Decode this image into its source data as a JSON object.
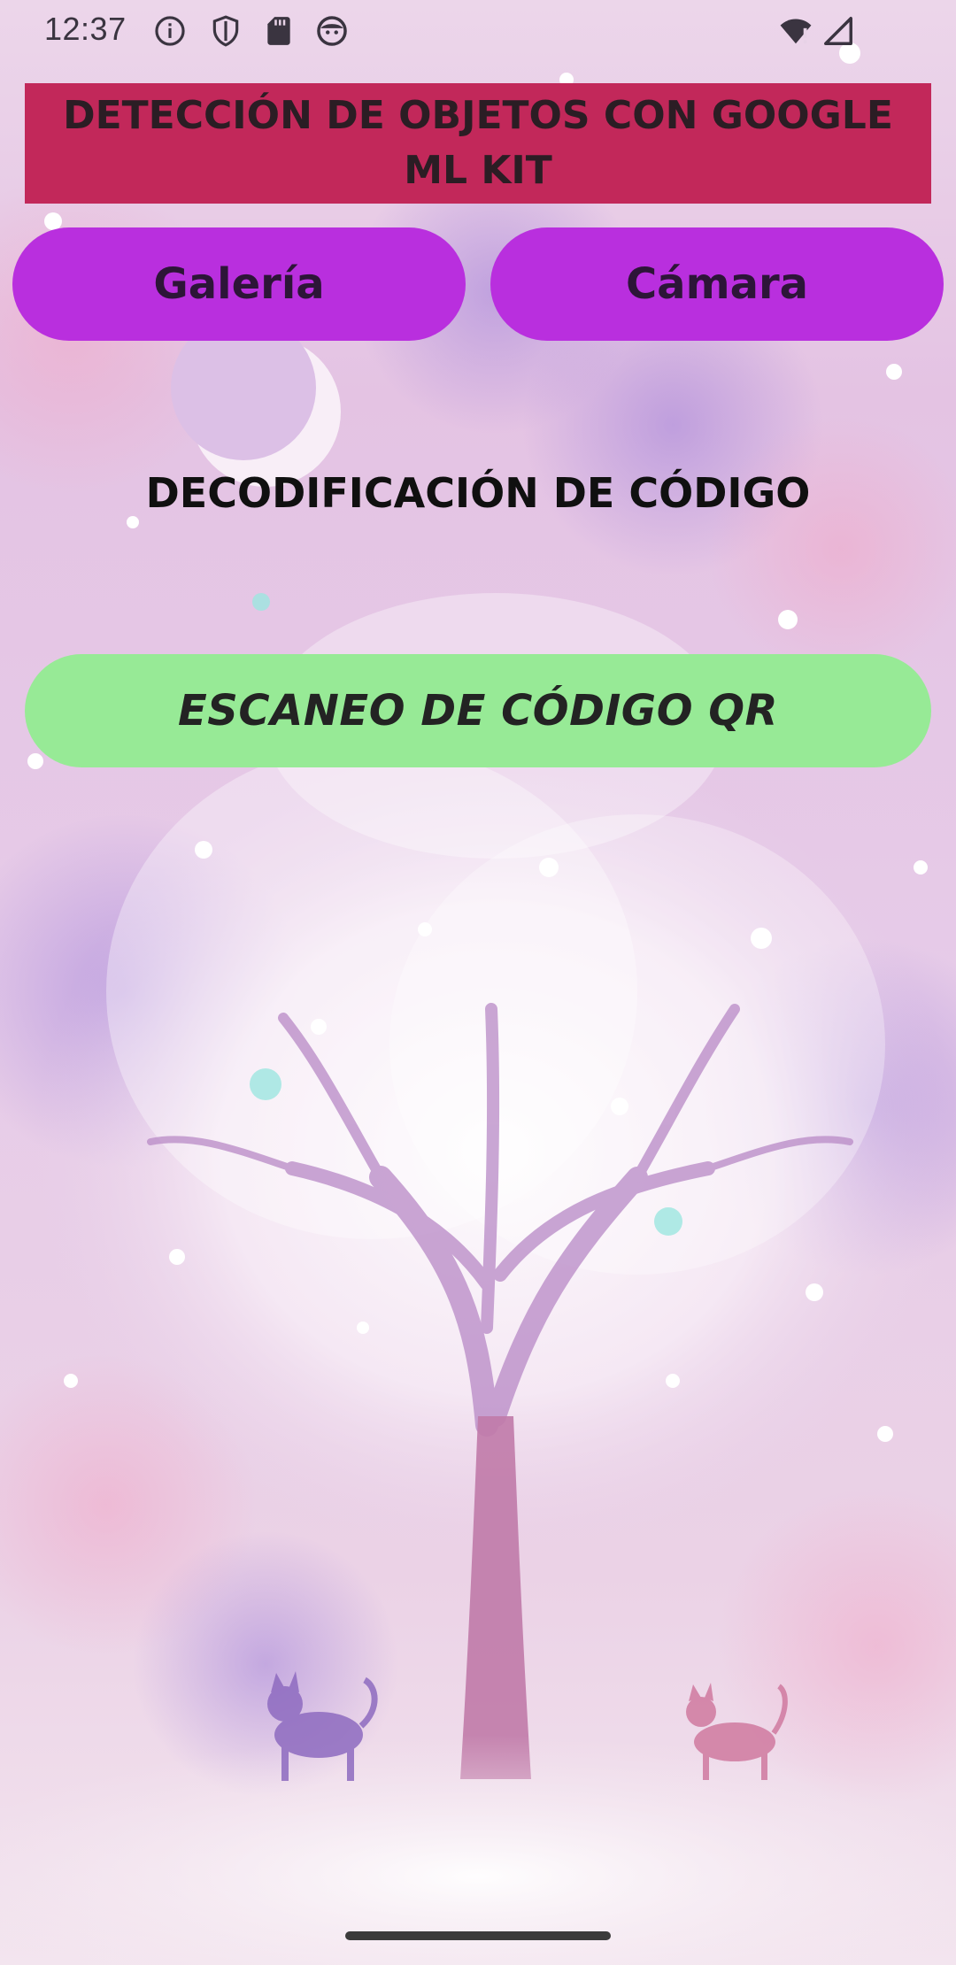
{
  "status_bar": {
    "time": "12:37",
    "icons_left": [
      "info-icon",
      "shield-icon",
      "sd-card-icon",
      "face-icon"
    ],
    "icons_right": [
      "wifi-alert-icon",
      "signal-icon"
    ]
  },
  "header": {
    "title": "DETECCIÓN DE OBJETOS CON GOOGLE ML KIT",
    "title_bg_color": "#c2285a"
  },
  "actions": {
    "gallery_label": "Galería",
    "camera_label": "Cámara",
    "button_color": "#b92fde"
  },
  "main": {
    "section_title": "DECODIFICACIÓN DE CÓDIGO",
    "scan_button_label": "ESCANEO DE CÓDIGO QR",
    "scan_button_color": "#97ea96"
  },
  "background": {
    "image": "pastel-glitter-tree-wallpaper"
  }
}
